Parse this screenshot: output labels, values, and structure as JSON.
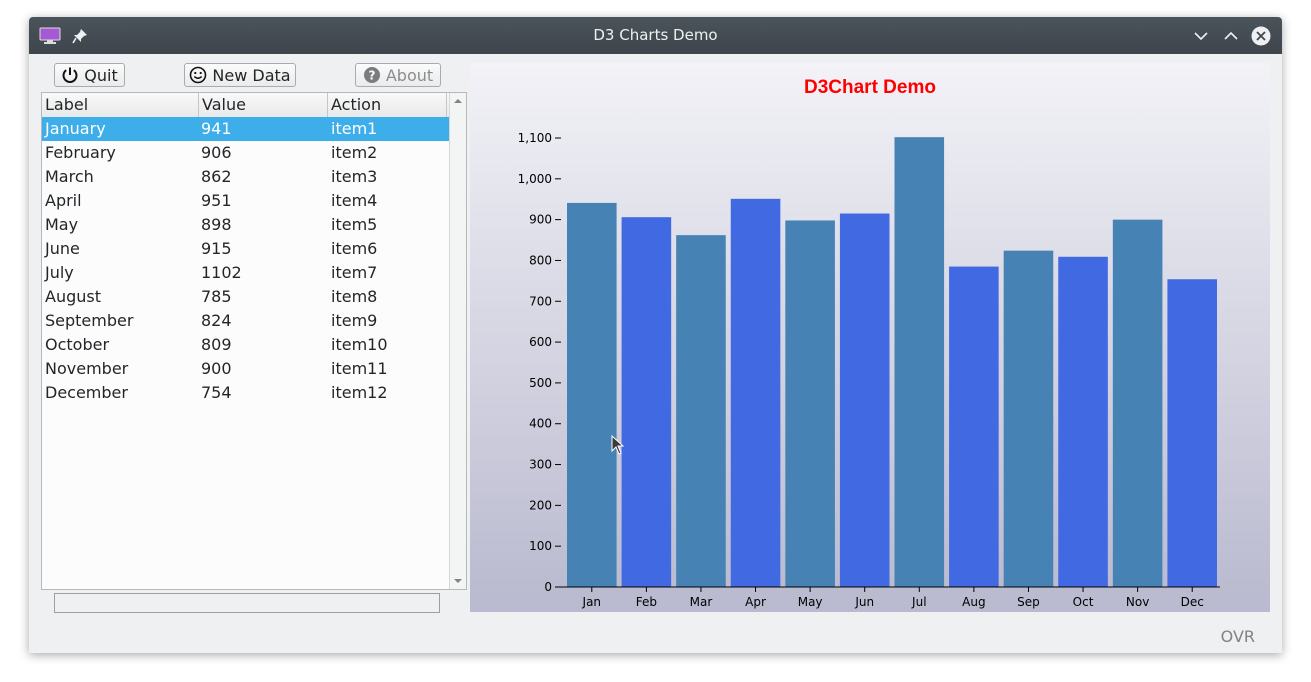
{
  "window": {
    "title": "D3 Charts Demo"
  },
  "toolbar": {
    "quit_label": "Quit",
    "new_data_label": "New Data",
    "about_label": "About"
  },
  "table": {
    "headers": [
      "Label",
      "Value",
      "Action"
    ],
    "rows": [
      {
        "label": "January",
        "value": "941",
        "action": "item1"
      },
      {
        "label": "February",
        "value": "906",
        "action": "item2"
      },
      {
        "label": "March",
        "value": "862",
        "action": "item3"
      },
      {
        "label": "April",
        "value": "951",
        "action": "item4"
      },
      {
        "label": "May",
        "value": "898",
        "action": "item5"
      },
      {
        "label": "June",
        "value": "915",
        "action": "item6"
      },
      {
        "label": "July",
        "value": "1102",
        "action": "item7"
      },
      {
        "label": "August",
        "value": "785",
        "action": "item8"
      },
      {
        "label": "September",
        "value": "824",
        "action": "item9"
      },
      {
        "label": "October",
        "value": "809",
        "action": "item10"
      },
      {
        "label": "November",
        "value": "900",
        "action": "item11"
      },
      {
        "label": "December",
        "value": "754",
        "action": "item12"
      }
    ],
    "selected_row": 0
  },
  "status": {
    "mode": "OVR"
  },
  "chart_data": {
    "type": "bar",
    "title": "D3Chart Demo",
    "categories": [
      "Jan",
      "Feb",
      "Mar",
      "Apr",
      "May",
      "Jun",
      "Jul",
      "Aug",
      "Sep",
      "Oct",
      "Nov",
      "Dec"
    ],
    "values": [
      941,
      906,
      862,
      951,
      898,
      915,
      1102,
      785,
      824,
      809,
      900,
      754
    ],
    "yticks": [
      "0",
      "100",
      "200",
      "300",
      "400",
      "500",
      "600",
      "700",
      "800",
      "900",
      "1,000",
      "1,100"
    ],
    "ylim": [
      0,
      1100
    ],
    "xlabel": "",
    "ylabel": "",
    "grid": false,
    "colors": {
      "odd": "#4682b4",
      "even": "#4169e1",
      "title": "#ff0000",
      "axis": "#000000"
    }
  }
}
